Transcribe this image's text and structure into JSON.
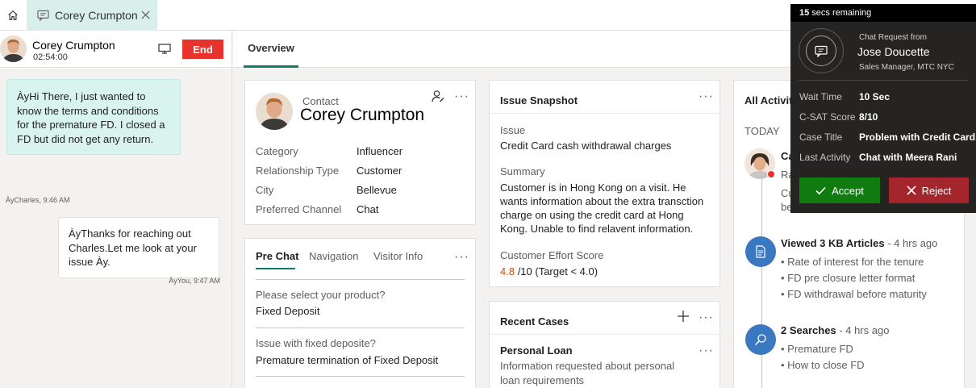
{
  "tabs": {
    "home_icon": "home-icon",
    "session": {
      "icon": "chat-icon",
      "label": "Corey Crumpton",
      "close_icon": "close-icon"
    }
  },
  "chat": {
    "customer_name": "Corey Crumpton",
    "timer": "02:54:00",
    "end_label": "End",
    "messages": [
      {
        "direction": "incoming",
        "text": "ÀyHi There, I just wanted to know the terms and conditions for the premature FD. I closed a FD but did not get any return.",
        "meta": "ÀyCharles, 9:46 AM"
      },
      {
        "direction": "outgoing",
        "text": "ÀyThanks for reaching out Charles.Let me look at your issue Ày.",
        "meta": "ÀyYou, 9:47 AM"
      }
    ]
  },
  "main": {
    "tab_overview": "Overview"
  },
  "contact": {
    "type_label": "Contact",
    "name": "Corey Crumpton",
    "fields": [
      {
        "label": "Category",
        "value": "Influencer"
      },
      {
        "label": "Relationship Type",
        "value": "Customer"
      },
      {
        "label": "City",
        "value": "Bellevue"
      },
      {
        "label": "Preferred Channel",
        "value": "Chat"
      }
    ]
  },
  "prechat": {
    "tabs": [
      "Pre Chat",
      "Navigation",
      "Visitor Info"
    ],
    "questions": [
      {
        "label": "Please select your product?",
        "value": "Fixed Deposit"
      },
      {
        "label": "Issue with fixed deposite?",
        "value": "Premature termination of Fixed Deposit"
      }
    ]
  },
  "issue": {
    "title": "Issue Snapshot",
    "issue_label": "Issue",
    "issue_value": "Credit Card cash withdrawal charges",
    "summary_label": "Summary",
    "summary_value": "Customer is in Hong Kong on a visit. He wants information about the extra transction charge on using the credit card at Hong Kong. Unable to find relavent information.",
    "effort_label": "Customer Effort Score",
    "effort_score": "4.8",
    "effort_rest": " /10 (Target < 4.0)",
    "score_color": "#ca5010"
  },
  "cases": {
    "title": "Recent Cases",
    "items": [
      {
        "title": "Personal Loan",
        "description": "Information requested about personal loan requirements"
      }
    ]
  },
  "activities": {
    "title": "All Activiti",
    "today": "TODAY",
    "partial": {
      "line1": "Ca",
      "line2": "Ra",
      "line3": "Cu",
      "line4": "be"
    },
    "kb": {
      "title": "Viewed 3 KB Articles",
      "ago": " - 4 hrs ago",
      "items": [
        "Rate of interest for the tenure",
        "FD pre closure letter format",
        "FD withdrawal before maturity"
      ]
    },
    "search": {
      "title": "2 Searches",
      "ago": " - 4 hrs ago",
      "items": [
        "Premature FD",
        "How to close FD"
      ]
    }
  },
  "popup": {
    "timer_value": "15",
    "timer_text": " secs remaining",
    "request_label": "Chat Request from",
    "caller_name": "Jose Doucette",
    "caller_role": "Sales Manager, MTC NYC",
    "details": [
      {
        "label": "Wait Time",
        "value": "10 Sec"
      },
      {
        "label": "C-SAT Score",
        "value": "8/10"
      },
      {
        "label": "Case Title",
        "value": "Problem with Credit Card"
      },
      {
        "label": "Last Activity",
        "value": "Chat with Meera Rani"
      }
    ],
    "accept_label": "Accept",
    "reject_label": "Reject",
    "accept_color": "#107c10",
    "reject_color": "#a4262c"
  }
}
